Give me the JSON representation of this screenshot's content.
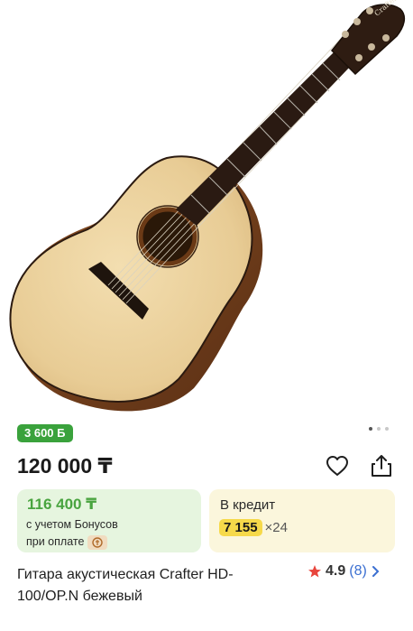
{
  "product": {
    "bonus_badge": "3 600 Б",
    "price": "120 000 ₸",
    "bonus_price": "116 400 ₸",
    "bonus_note_line1": "с учетом Бонусов",
    "bonus_note_line2": "при оплате",
    "credit_label": "В кредит",
    "credit_amount": "7 155",
    "credit_multiplier": "×24",
    "title": "Гитара акустическая Crafter HD-100/OP.N бежевый",
    "rating": "4.9",
    "reviews": "(8)",
    "guitar_brand": "Crafter"
  },
  "gallery": {
    "total": 3,
    "active": 1
  },
  "icons": [
    "heart-icon",
    "share-icon",
    "star-icon",
    "chevron-right-icon",
    "payment-icon"
  ],
  "colors": {
    "bonus_green": "#3aa23c",
    "bonus_card": "#e6f5df",
    "credit_card": "#fbf6dc",
    "credit_highlight": "#f6d94a",
    "star": "#e8453c",
    "link_blue": "#3b6fd1"
  }
}
